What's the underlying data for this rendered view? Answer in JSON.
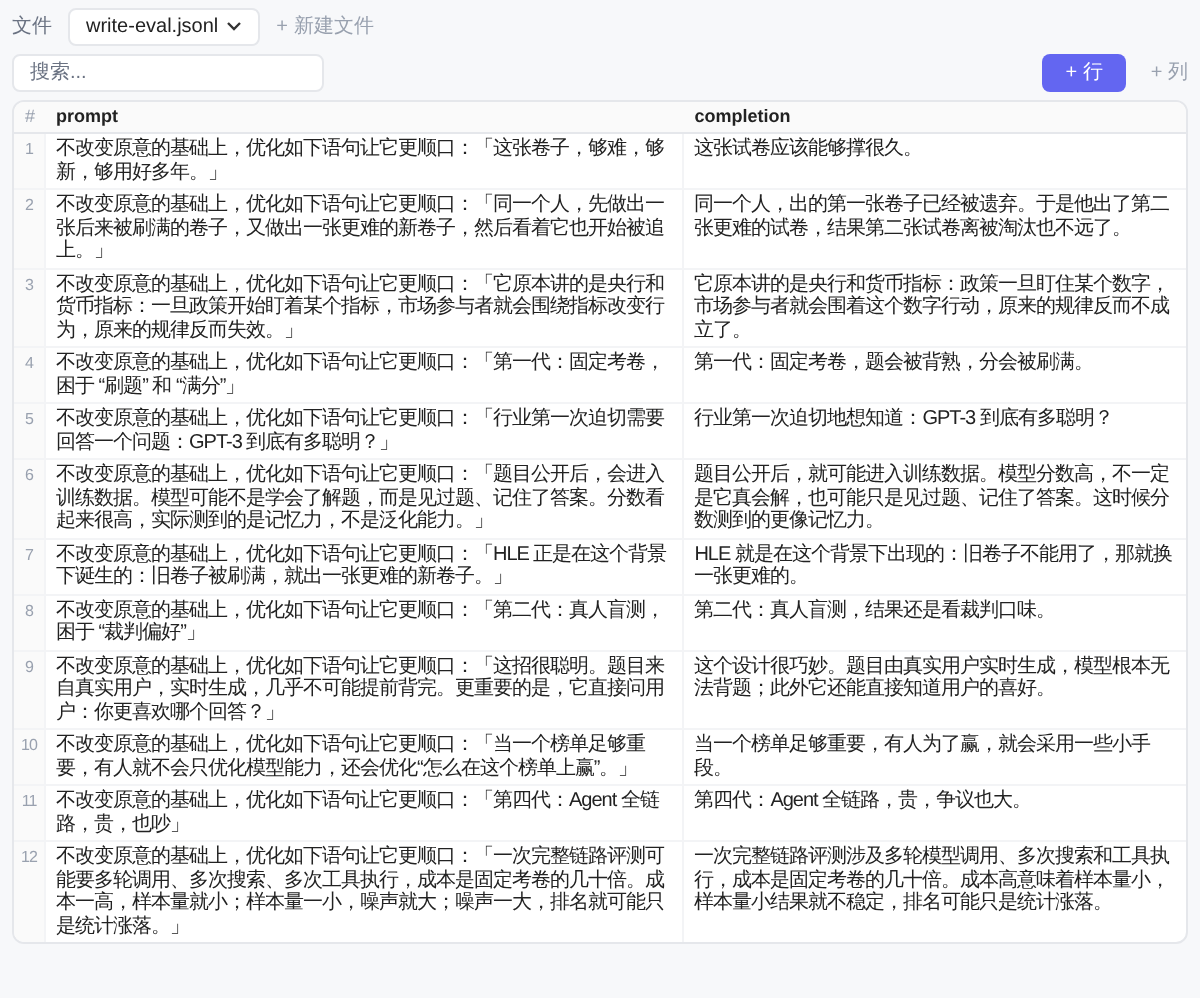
{
  "file_bar": {
    "label": "文件",
    "file_select": "write-eval.jsonl",
    "new_file": "+ 新建文件"
  },
  "toolbar": {
    "search": {
      "placeholder": "搜索..."
    },
    "add_row": "+ 行",
    "add_column": "+ 列"
  },
  "table": {
    "columns": [
      "#",
      "prompt",
      "completion"
    ],
    "rows": [
      {
        "index": "1",
        "prompt": "不改变原意的基础上，优化如下语句让它更顺口：「这张卷子，够难，够新，够用好多年。」",
        "completion": "这张试卷应该能够撑很久。"
      },
      {
        "index": "2",
        "prompt": "不改变原意的基础上，优化如下语句让它更顺口：「同一个人，先做出一张后来被刷满的卷子，又做出一张更难的新卷子，然后看着它也开始被追上。」",
        "completion": "同一个人，出的第一张卷子已经被遗弃。于是他出了第二张更难的试卷，结果第二张试卷离被淘汰也不远了。"
      },
      {
        "index": "3",
        "prompt": "不改变原意的基础上，优化如下语句让它更顺口：「它原本讲的是央行和货币指标：一旦政策开始盯着某个指标，市场参与者就会围绕指标改变行为，原来的规律反而失效。」",
        "completion": "它原本讲的是央行和货币指标：政策一旦盯住某个数字，市场参与者就会围着这个数字行动，原来的规律反而不成立了。"
      },
      {
        "index": "4",
        "prompt": "不改变原意的基础上，优化如下语句让它更顺口：「第一代：固定考卷，困于 “刷题” 和 “满分”」",
        "completion": "第一代：固定考卷，题会被背熟，分会被刷满。"
      },
      {
        "index": "5",
        "prompt": "不改变原意的基础上，优化如下语句让它更顺口：「行业第一次迫切需要回答一个问题：GPT-3 到底有多聪明？」",
        "completion": "行业第一次迫切地想知道：GPT-3 到底有多聪明？"
      },
      {
        "index": "6",
        "prompt": "不改变原意的基础上，优化如下语句让它更顺口：「题目公开后，会进入训练数据。模型可能不是学会了解题，而是见过题、记住了答案。分数看起来很高，实际测到的是记忆力，不是泛化能力。」",
        "completion": "题目公开后，就可能进入训练数据。模型分数高，不一定是它真会解，也可能只是见过题、记住了答案。这时候分数测到的更像记忆力。"
      },
      {
        "index": "7",
        "prompt": "不改变原意的基础上，优化如下语句让它更顺口：「HLE 正是在这个背景下诞生的：旧卷子被刷满，就出一张更难的新卷子。」",
        "completion": "HLE 就是在这个背景下出现的：旧卷子不能用了，那就换一张更难的。"
      },
      {
        "index": "8",
        "prompt": "不改变原意的基础上，优化如下语句让它更顺口：「第二代：真人盲测，困于 “裁判偏好”」",
        "completion": "第二代：真人盲测，结果还是看裁判口味。"
      },
      {
        "index": "9",
        "prompt": "不改变原意的基础上，优化如下语句让它更顺口：「这招很聪明。题目来自真实用户，实时生成，几乎不可能提前背完。更重要的是，它直接问用户：你更喜欢哪个回答？」",
        "completion": "这个设计很巧妙。题目由真实用户实时生成，模型根本无法背题；此外它还能直接知道用户的喜好。"
      },
      {
        "index": "10",
        "prompt": "不改变原意的基础上，优化如下语句让它更顺口：「当一个榜单足够重要，有人就不会只优化模型能力，还会优化“怎么在这个榜单上赢”。」",
        "completion": "当一个榜单足够重要，有人为了赢，就会采用一些小手段。"
      },
      {
        "index": "11",
        "prompt": "不改变原意的基础上，优化如下语句让它更顺口：「第四代：Agent 全链路，贵，也吵」",
        "completion": "第四代：Agent 全链路，贵，争议也大。"
      },
      {
        "index": "12",
        "prompt": "不改变原意的基础上，优化如下语句让它更顺口：「一次完整链路评测可能要多轮调用、多次搜索、多次工具执行，成本是固定考卷的几十倍。成本一高，样本量就小；样本量一小，噪声就大；噪声一大，排名就可能只是统计涨落。」",
        "completion": "一次完整链路评测涉及多轮模型调用、多次搜索和工具执行，成本是固定考卷的几十倍。成本高意味着样本量小，样本量小结果就不稳定，排名可能只是统计涨落。"
      }
    ]
  }
}
